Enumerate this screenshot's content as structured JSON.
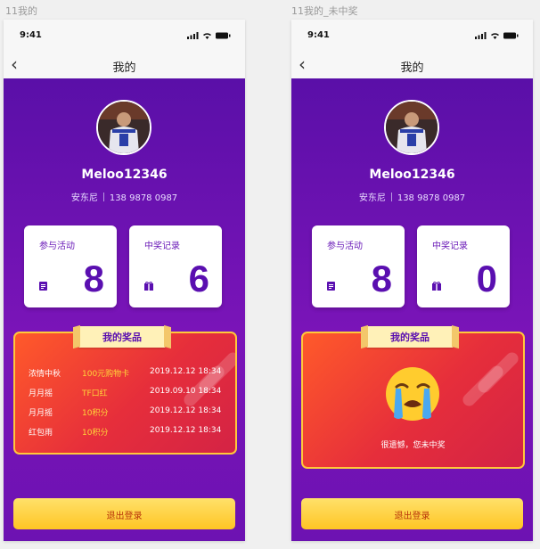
{
  "artboards": [
    {
      "label": "11我的",
      "status_time": "9:41",
      "nav_title": "我的",
      "username": "Meloo12346",
      "nickname": "安东尼",
      "phone": "138 9878 0987",
      "cards": [
        {
          "title": "参与活动",
          "value": "8",
          "icon": "document-icon"
        },
        {
          "title": "中奖记录",
          "value": "6",
          "icon": "gift-icon"
        }
      ],
      "prize_title": "我的奖品",
      "prizes": [
        {
          "activity": "浓情中秋",
          "prize": "100元购物卡",
          "time": "2019.12.12 18:34"
        },
        {
          "activity": "月月摇",
          "prize": "TF口红",
          "time": "2019.09.10 18:34"
        },
        {
          "activity": "月月摇",
          "prize": "10积分",
          "time": "2019.12.12 18:34"
        },
        {
          "activity": "红包雨",
          "prize": "10积分",
          "time": "2019.12.12 18:34"
        }
      ],
      "logout_label": "退出登录"
    },
    {
      "label": "11我的_未中奖",
      "status_time": "9:41",
      "nav_title": "我的",
      "username": "Meloo12346",
      "nickname": "安东尼",
      "phone": "138 9878 0987",
      "cards": [
        {
          "title": "参与活动",
          "value": "8",
          "icon": "document-icon"
        },
        {
          "title": "中奖记录",
          "value": "0",
          "icon": "gift-icon"
        }
      ],
      "prize_title": "我的奖品",
      "empty_message": "很遗憾，您未中奖",
      "empty_icon": "crying-face-emoji",
      "logout_label": "退出登录"
    }
  ],
  "colors": {
    "purple": "#6a12b0",
    "accent_yellow": "#ffc524",
    "prize_red": "#e62e3b",
    "number_purple": "#5a0fb0"
  }
}
